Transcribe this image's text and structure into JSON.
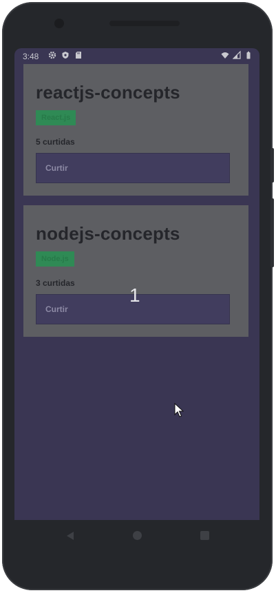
{
  "status_bar": {
    "time": "3:48",
    "left_icons": [
      "gear-icon",
      "shield-icon",
      "sd-card-icon"
    ],
    "right_icons": [
      "wifi-icon",
      "signal-icon",
      "battery-icon"
    ]
  },
  "repositories": [
    {
      "title": "reactjs-concepts",
      "tech": "React.js",
      "likes": "5 curtidas",
      "like_button": "Curtir"
    },
    {
      "title": "nodejs-concepts",
      "tech": "Node.js",
      "likes": "3 curtidas",
      "like_button": "Curtir"
    }
  ],
  "overlay": {
    "number": "1"
  },
  "colors": {
    "screen_bg": "#3a3653",
    "card_bg": "#5d5e62",
    "badge_bg": "#2f8a55",
    "button_bg": "#413d5e"
  }
}
